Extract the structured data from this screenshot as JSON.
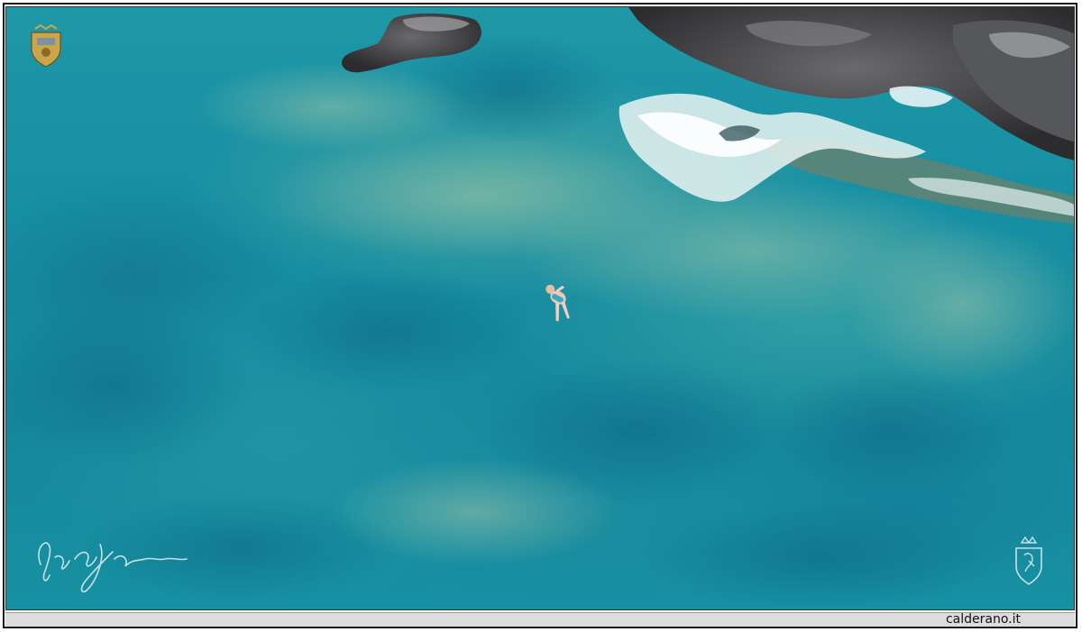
{
  "footer": {
    "site_label": "calderano.it"
  },
  "photo": {
    "subject": "swimmer-floating-in-clear-sea",
    "colors": {
      "water": "#168fa3",
      "rock": "#3e3e40",
      "foam": "#e9f3f2",
      "caption_bar": "#dcdcdc"
    }
  },
  "marks": {
    "top_left_emblem": "crest-icon",
    "bottom_left_signature": "signature-icon",
    "bottom_right_emblem": "crest-icon"
  }
}
